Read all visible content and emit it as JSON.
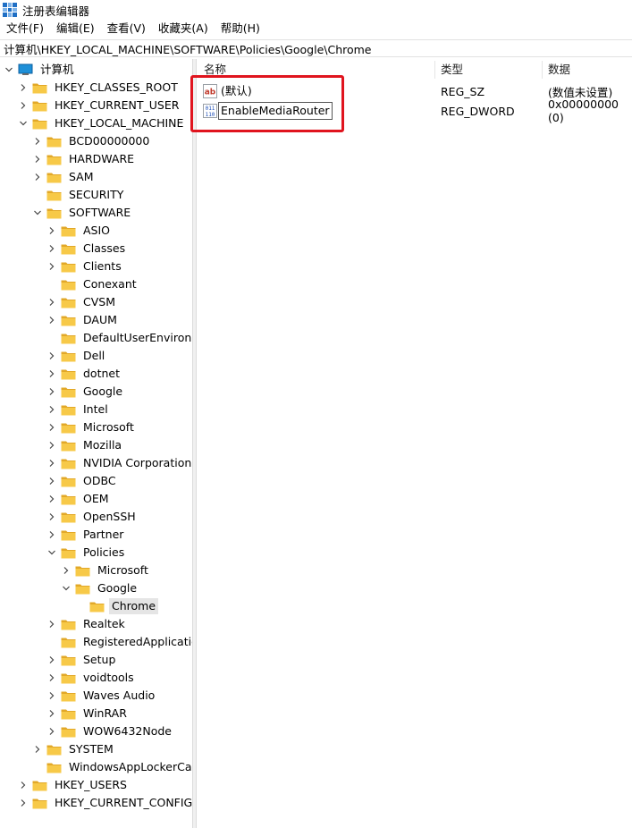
{
  "window": {
    "title": "注册表编辑器"
  },
  "menu": [
    {
      "key": "file",
      "label": "文件(F)"
    },
    {
      "key": "edit",
      "label": "编辑(E)"
    },
    {
      "key": "view",
      "label": "查看(V)"
    },
    {
      "key": "favorites",
      "label": "收藏夹(A)"
    },
    {
      "key": "help",
      "label": "帮助(H)"
    }
  ],
  "address": {
    "path": "计算机\\HKEY_LOCAL_MACHINE\\SOFTWARE\\Policies\\Google\\Chrome"
  },
  "tree": {
    "root": {
      "label": "计算机",
      "expanded": true
    },
    "nodes": [
      {
        "label": "HKEY_CLASSES_ROOT",
        "level": 1,
        "chevron": "right"
      },
      {
        "label": "HKEY_CURRENT_USER",
        "level": 1,
        "chevron": "right"
      },
      {
        "label": "HKEY_LOCAL_MACHINE",
        "level": 1,
        "chevron": "down"
      },
      {
        "label": "BCD00000000",
        "level": 2,
        "chevron": "right"
      },
      {
        "label": "HARDWARE",
        "level": 2,
        "chevron": "right"
      },
      {
        "label": "SAM",
        "level": 2,
        "chevron": "right"
      },
      {
        "label": "SECURITY",
        "level": 2,
        "chevron": "none"
      },
      {
        "label": "SOFTWARE",
        "level": 2,
        "chevron": "down"
      },
      {
        "label": "ASIO",
        "level": 3,
        "chevron": "right"
      },
      {
        "label": "Classes",
        "level": 3,
        "chevron": "right"
      },
      {
        "label": "Clients",
        "level": 3,
        "chevron": "right"
      },
      {
        "label": "Conexant",
        "level": 3,
        "chevron": "none"
      },
      {
        "label": "CVSM",
        "level": 3,
        "chevron": "right"
      },
      {
        "label": "DAUM",
        "level": 3,
        "chevron": "right"
      },
      {
        "label": "DefaultUserEnvironme",
        "level": 3,
        "chevron": "none"
      },
      {
        "label": "Dell",
        "level": 3,
        "chevron": "right"
      },
      {
        "label": "dotnet",
        "level": 3,
        "chevron": "right"
      },
      {
        "label": "Google",
        "level": 3,
        "chevron": "right"
      },
      {
        "label": "Intel",
        "level": 3,
        "chevron": "right"
      },
      {
        "label": "Microsoft",
        "level": 3,
        "chevron": "right"
      },
      {
        "label": "Mozilla",
        "level": 3,
        "chevron": "right"
      },
      {
        "label": "NVIDIA Corporation",
        "level": 3,
        "chevron": "right"
      },
      {
        "label": "ODBC",
        "level": 3,
        "chevron": "right"
      },
      {
        "label": "OEM",
        "level": 3,
        "chevron": "right"
      },
      {
        "label": "OpenSSH",
        "level": 3,
        "chevron": "right"
      },
      {
        "label": "Partner",
        "level": 3,
        "chevron": "right"
      },
      {
        "label": "Policies",
        "level": 3,
        "chevron": "down"
      },
      {
        "label": "Microsoft",
        "level": 4,
        "chevron": "right"
      },
      {
        "label": "Google",
        "level": 4,
        "chevron": "down"
      },
      {
        "label": "Chrome",
        "level": 5,
        "chevron": "none",
        "selected": true
      },
      {
        "label": "Realtek",
        "level": 3,
        "chevron": "right"
      },
      {
        "label": "RegisteredApplication",
        "level": 3,
        "chevron": "none"
      },
      {
        "label": "Setup",
        "level": 3,
        "chevron": "right"
      },
      {
        "label": "voidtools",
        "level": 3,
        "chevron": "right"
      },
      {
        "label": "Waves Audio",
        "level": 3,
        "chevron": "right"
      },
      {
        "label": "WinRAR",
        "level": 3,
        "chevron": "right"
      },
      {
        "label": "WOW6432Node",
        "level": 3,
        "chevron": "right"
      },
      {
        "label": "SYSTEM",
        "level": 2,
        "chevron": "right"
      },
      {
        "label": "WindowsAppLockerCach",
        "level": 2,
        "chevron": "none"
      },
      {
        "label": "HKEY_USERS",
        "level": 1,
        "chevron": "right"
      },
      {
        "label": "HKEY_CURRENT_CONFIG",
        "level": 1,
        "chevron": "right"
      }
    ]
  },
  "list": {
    "columns": {
      "name": "名称",
      "type": "类型",
      "data": "数据"
    },
    "rows": [
      {
        "name": "(默认)",
        "type": "REG_SZ",
        "data": "(数值未设置)",
        "icon": "string-value-icon"
      },
      {
        "name": "EnableMediaRouter",
        "type": "REG_DWORD",
        "data": "0x00000000 (0)",
        "icon": "binary-value-icon",
        "focused": true
      }
    ]
  },
  "colors": {
    "folder": "#f7c948",
    "folder_dark": "#e2a828",
    "highlight": "#e0141e",
    "selection": "#e5e5e5"
  }
}
